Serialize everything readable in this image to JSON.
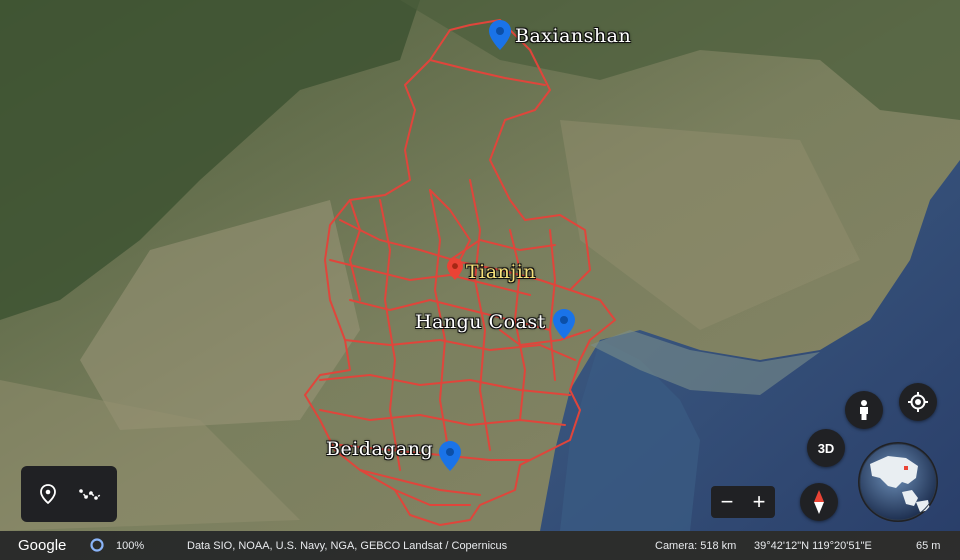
{
  "places": [
    {
      "name": "Baxianshan",
      "pin_color": "#1a73e8",
      "highlight": false
    },
    {
      "name": "Tianjin",
      "pin_color": "#ea4335",
      "highlight": true
    },
    {
      "name": "Hangu Coast",
      "pin_color": "#1a73e8",
      "highlight": false
    },
    {
      "name": "Beidagang",
      "pin_color": "#1a73e8",
      "highlight": false
    }
  ],
  "route_color": "#e0453b",
  "controls": {
    "three_d_label": "3D",
    "zoom_out_label": "−",
    "zoom_in_label": "+"
  },
  "status": {
    "logo": "Google",
    "load_percent": "100%",
    "credits": "Data SIO, NOAA, U.S. Navy, NGA, GEBCO  Landsat / Copernicus",
    "camera": "Camera: 518 km",
    "coordinates": "39°42'12\"N 119°20'51\"E",
    "elevation": "65 m"
  },
  "icons": [
    "place-pin-icon",
    "path-measure-icon",
    "street-view-person-icon",
    "my-location-icon",
    "compass-icon",
    "globe-icon"
  ]
}
